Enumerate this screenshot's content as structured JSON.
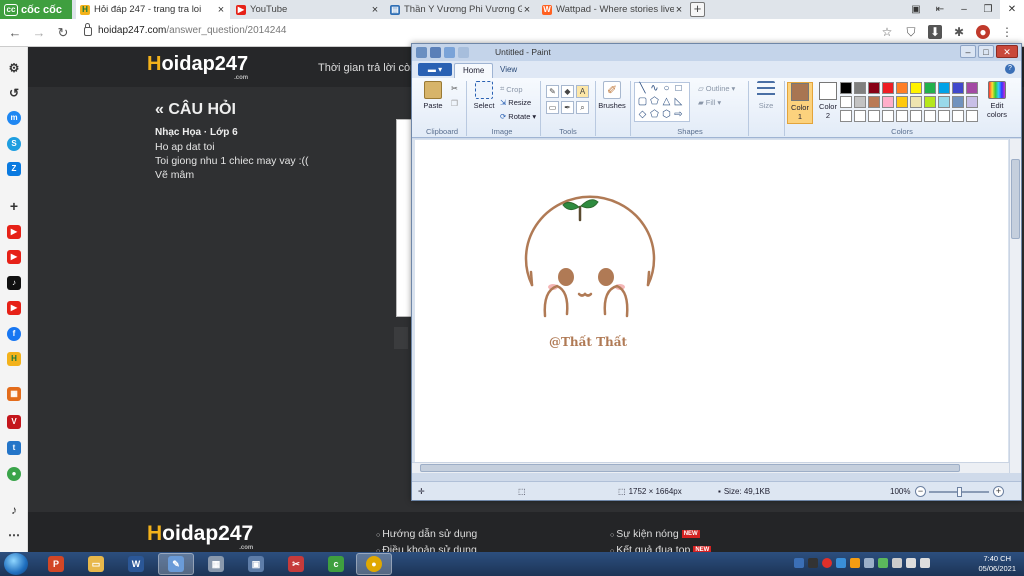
{
  "browser": {
    "brand_label": "cốc cốc",
    "tabs": [
      {
        "title": "Hỏi đáp 247 - trang tra loi",
        "active": true,
        "icon": "hoidap-h-icon"
      },
      {
        "title": "YouTube",
        "active": false,
        "icon": "youtube-icon"
      },
      {
        "title": "Thần Y Vương Phi Vương Gi",
        "active": false,
        "icon": "book-icon"
      },
      {
        "title": "Wattpad - Where stories live",
        "active": false,
        "icon": "wattpad-icon"
      }
    ],
    "new_tab": "+",
    "url_host": "hoidap247.com",
    "url_path": "/answer_question/2014244"
  },
  "site": {
    "logo_h": "H",
    "logo_rest": "oidap247",
    "logo_com": ".com",
    "header_text": "Thời gian trả lời còn:",
    "section_title": "« CÂU HỎI",
    "subject": "Nhạc Họa · Lớp 6",
    "question_lines": [
      "Ho ap dat toi",
      "Toi giong nhu 1 chiec may vay :((",
      "Vẽ mâm"
    ],
    "footer_links": [
      {
        "label": "Hướng dẫn sử dụng",
        "badge": ""
      },
      {
        "label": "Điều khoản sử dụng",
        "badge": ""
      },
      {
        "label": "Sự kiện nóng",
        "badge": "NEW"
      },
      {
        "label": "Kết quả đua top",
        "badge": "NEW"
      }
    ]
  },
  "paint": {
    "title": "Untitled - Paint",
    "tabs": [
      "Home",
      "View"
    ],
    "groups": {
      "clipboard": "Clipboard",
      "image": "Image",
      "tools": "Tools",
      "shapes": "Shapes",
      "colors": "Colors"
    },
    "buttons": {
      "paste": "Paste",
      "select": "Select",
      "crop": "Crop",
      "resize": "Resize",
      "rotate": "Rotate",
      "brushes": "Brushes",
      "outline": "Outline",
      "fill": "Fill",
      "size": "Size",
      "color1": "Color\n1",
      "color2": "Color\n2",
      "edit_colors": "Edit\ncolors"
    },
    "color1_value": "#a87552",
    "color2_value": "#ffffff",
    "palette": [
      "#000000",
      "#7f7f7f",
      "#880015",
      "#ed1c24",
      "#ff7f27",
      "#fff200",
      "#22b14c",
      "#00a2e8",
      "#3f48cc",
      "#a349a4",
      "#ffffff",
      "#c3c3c3",
      "#b97a57",
      "#ffaec9",
      "#ffc90e",
      "#efe4b0",
      "#b5e61d",
      "#99d9ea",
      "#7092be",
      "#c8bfe7",
      "#ffffff",
      "#ffffff",
      "#ffffff",
      "#ffffff",
      "#ffffff",
      "#ffffff",
      "#ffffff",
      "#ffffff",
      "#ffffff",
      "#ffffff"
    ],
    "drawing_caption": "@Thất Thất",
    "drawing_color": "#b07a55",
    "status": {
      "dimensions": "1752 × 1664px",
      "size": "Size: 49,1KB",
      "zoom": "100%"
    }
  },
  "taskbar": {
    "time": "7:40 CH",
    "date": "05/06/2021"
  }
}
